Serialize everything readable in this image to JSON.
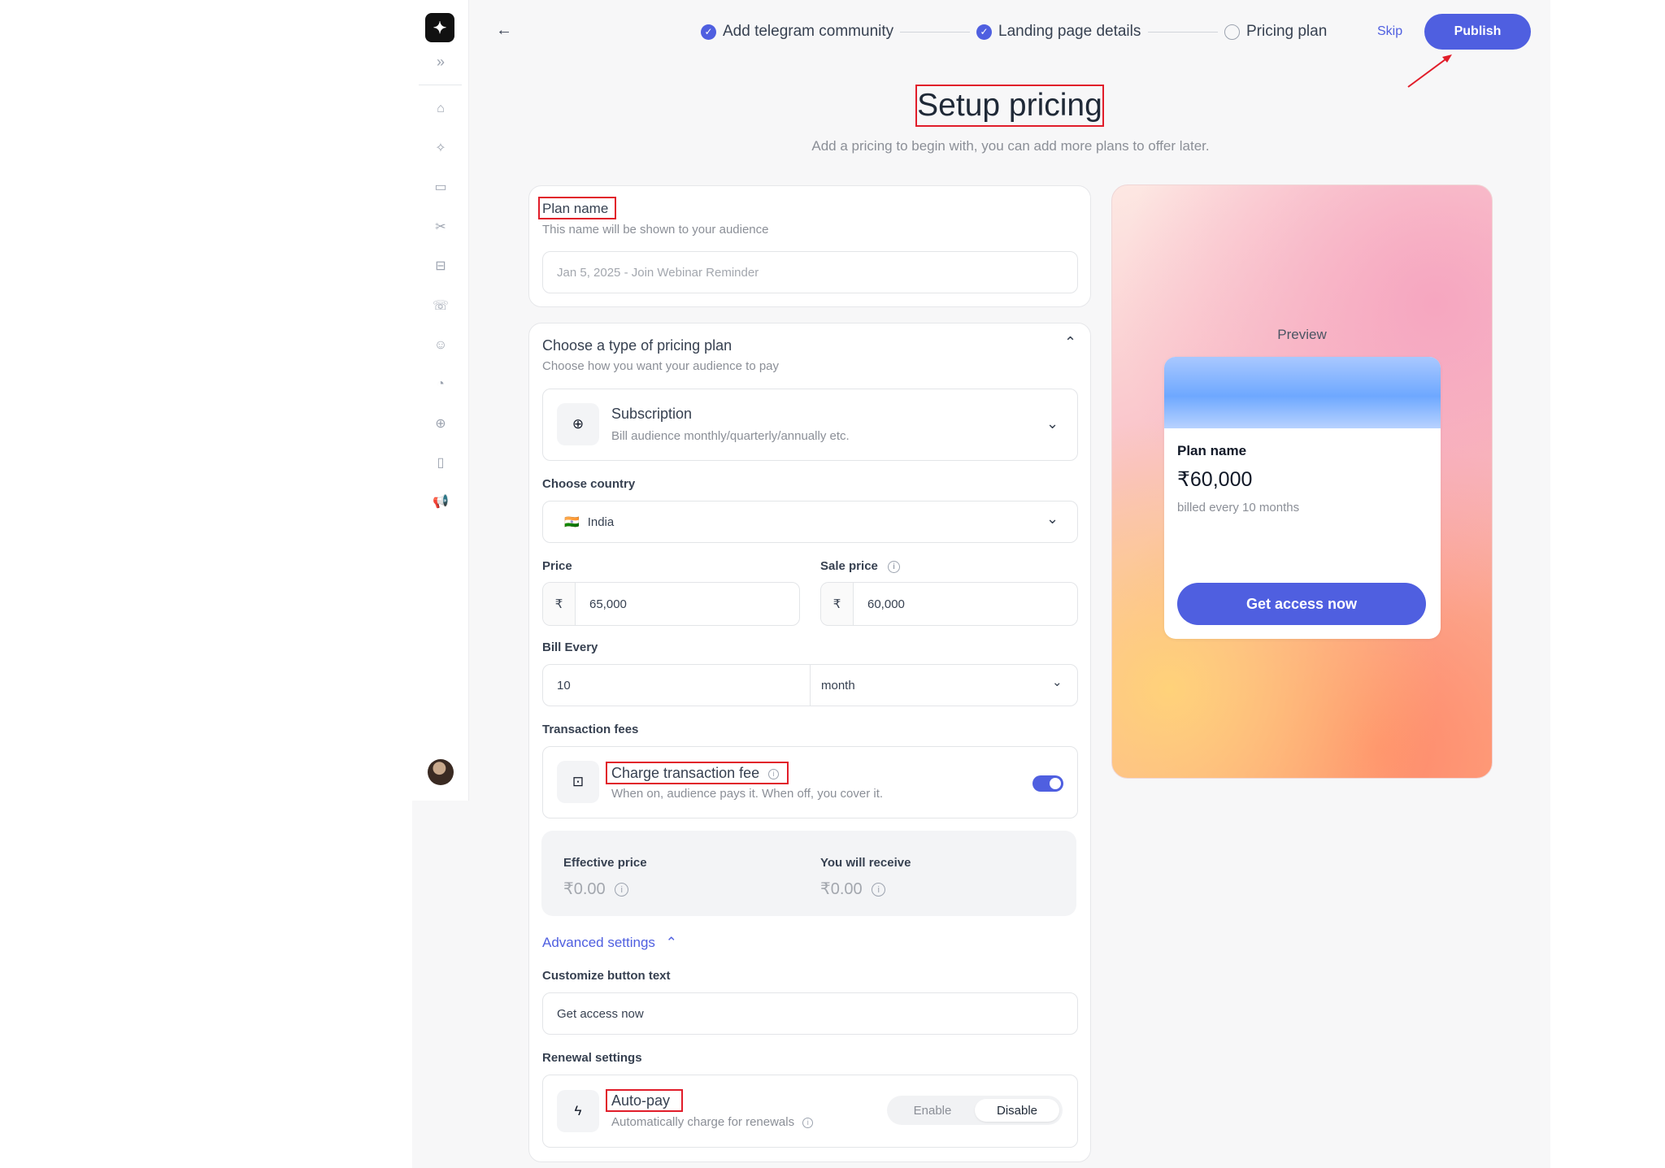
{
  "sidebar": {
    "logo_glyph": "✦",
    "expand_glyph": "»",
    "items": [
      {
        "name": "home-icon",
        "glyph": "⌂"
      },
      {
        "name": "sparkle-icon",
        "glyph": "✧"
      },
      {
        "name": "archive-icon",
        "glyph": "▭"
      },
      {
        "name": "tools-icon",
        "glyph": "✂"
      },
      {
        "name": "book-icon",
        "glyph": "⊟"
      },
      {
        "name": "chat-icon",
        "glyph": "☏"
      },
      {
        "name": "user-icon",
        "glyph": "☺"
      },
      {
        "name": "chart-icon",
        "glyph": "◔"
      },
      {
        "name": "globe-icon",
        "glyph": "⊕"
      },
      {
        "name": "mobile-icon",
        "glyph": "▯"
      },
      {
        "name": "megaphone-icon",
        "glyph": "📢",
        "active": true
      }
    ]
  },
  "header": {
    "back_glyph": "←",
    "steps": [
      {
        "label": "Add telegram community",
        "done": true
      },
      {
        "label": "Landing page details",
        "done": true
      },
      {
        "label": "Pricing plan",
        "done": false
      }
    ],
    "skip_label": "Skip",
    "publish_label": "Publish"
  },
  "page": {
    "title": "Setup pricing",
    "subtitle": "Add a pricing to begin with, you can add more plans to offer later."
  },
  "plan_name": {
    "label": "Plan name",
    "hint": "This name will be shown to your audience",
    "placeholder": "Jan 5, 2025 - Join Webinar Reminder"
  },
  "pricing_type": {
    "heading": "Choose a type of pricing plan",
    "hint": "Choose how you want your audience to pay",
    "selected_title": "Subscription",
    "selected_desc": "Bill audience monthly/quarterly/annually etc."
  },
  "country": {
    "label": "Choose country",
    "flag": "🇮🇳",
    "value": "India"
  },
  "price": {
    "label": "Price",
    "currency": "₹",
    "value": "65,000"
  },
  "sale_price": {
    "label": "Sale price",
    "currency": "₹",
    "value": "60,000"
  },
  "bill_every": {
    "label": "Bill Every",
    "count": "10",
    "unit": "month"
  },
  "transaction_fees": {
    "label": "Transaction fees",
    "title": "Charge transaction fee",
    "desc": "When on, audience pays it. When off, you cover it.",
    "enabled": true
  },
  "summary": {
    "effective_label": "Effective price",
    "effective_value": "₹0.00",
    "receive_label": "You will receive",
    "receive_value": "₹0.00"
  },
  "advanced": {
    "label": "Advanced settings",
    "button_text_label": "Customize button text",
    "button_text_value": "Get access now",
    "renewal_label": "Renewal settings",
    "autopay_title": "Auto-pay",
    "autopay_desc": "Automatically charge for renewals",
    "enable_label": "Enable",
    "disable_label": "Disable",
    "selected": "Disable"
  },
  "preview": {
    "label": "Preview",
    "plan_name": "Plan name",
    "price": "₹60,000",
    "billing": "billed every 10 months",
    "button": "Get access now"
  },
  "colors": {
    "accent": "#4f5fe0",
    "annotation": "#e11d2a"
  }
}
